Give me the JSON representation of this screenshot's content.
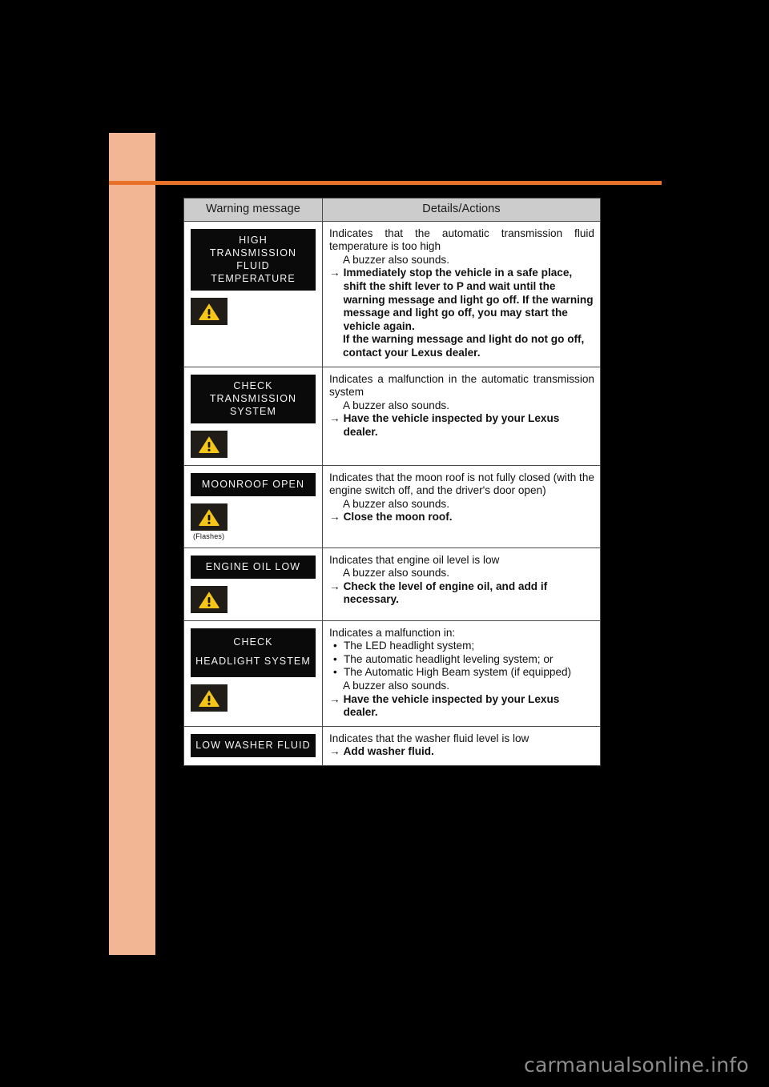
{
  "page": {
    "accent_band_color": "#f2b694",
    "accent_rule_color": "#e8712a",
    "watermark": "carmanualsonline.info"
  },
  "table": {
    "headers": {
      "message": "Warning message",
      "details": "Details/Actions"
    },
    "rows": [
      {
        "display_lines": [
          "HIGH",
          "TRANSMISSION FLUID",
          "TEMPERATURE"
        ],
        "icon": "warning-triangle-icon",
        "icon_note": "",
        "detail_intro": "Indicates that the automatic transmission fluid temperature is too high",
        "buzzer": "A buzzer also sounds.",
        "bullets": [],
        "action": "Immediately stop the vehicle in a safe place, shift the shift lever to P and wait until the warning message and light go off. If the warning message and light go off, you may start the vehicle again.",
        "action_extra": "If the warning message and light do not go off, contact your Lexus dealer."
      },
      {
        "display_lines": [
          "CHECK",
          "TRANSMISSION",
          "SYSTEM"
        ],
        "icon": "warning-triangle-icon",
        "icon_note": "",
        "detail_intro": "Indicates a malfunction in the automatic transmission system",
        "buzzer": "A buzzer also sounds.",
        "bullets": [],
        "action": "Have the vehicle inspected by your Lexus dealer.",
        "action_extra": ""
      },
      {
        "display_lines": [
          "MOONROOF OPEN"
        ],
        "icon": "warning-triangle-icon",
        "icon_note": "(Flashes)",
        "detail_intro": "Indicates that the moon roof is not fully closed (with the engine switch off, and the driver's door open)",
        "buzzer": "A buzzer also sounds.",
        "bullets": [],
        "action": "Close the moon roof.",
        "action_extra": ""
      },
      {
        "display_lines": [
          "ENGINE OIL LOW"
        ],
        "icon": "warning-triangle-icon",
        "icon_note": "",
        "detail_intro": "Indicates that engine oil level is low",
        "buzzer": "A buzzer also sounds.",
        "bullets": [],
        "action": "Check the level of engine oil, and add if necessary.",
        "action_extra": ""
      },
      {
        "display_lines": [
          "CHECK",
          "HEADLIGHT SYSTEM"
        ],
        "icon": "warning-triangle-icon",
        "icon_note": "",
        "detail_intro": "Indicates a malfunction in:",
        "buzzer": "A buzzer also sounds.",
        "bullets": [
          "The LED headlight system;",
          "The automatic headlight leveling system; or",
          "The Automatic High Beam system (if equipped)"
        ],
        "action": "Have the vehicle inspected by your Lexus dealer.",
        "action_extra": ""
      },
      {
        "display_lines": [
          "LOW WASHER FLUID"
        ],
        "icon": "",
        "icon_note": "",
        "detail_intro": "Indicates that the washer fluid level is low",
        "buzzer": "",
        "bullets": [],
        "action": "Add washer fluid.",
        "action_extra": ""
      }
    ],
    "arrow_glyph": "→",
    "bullet_glyph": "•"
  },
  "colors": {
    "display_bg": "#0a0a0a",
    "display_text": "#f4f4f4",
    "warning_yellow": "#f5c518",
    "header_bg": "#cccccc"
  }
}
